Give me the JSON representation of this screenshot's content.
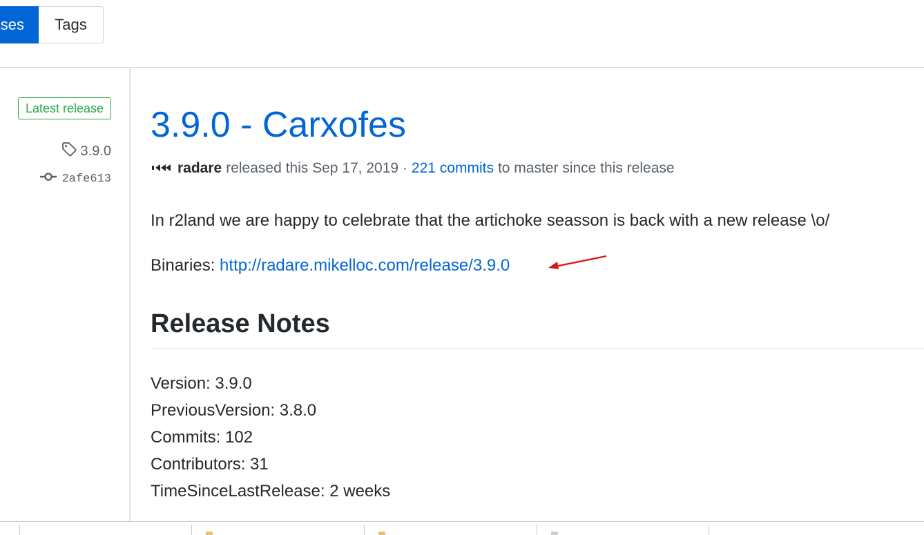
{
  "tabs": {
    "releases": "ses",
    "tags": "Tags"
  },
  "sidebar": {
    "badge": "Latest release",
    "tag": "3.9.0",
    "commit": "2afe613"
  },
  "release": {
    "title": "3.9.0 - Carxofes",
    "author": "radare",
    "released_text": "released this Sep 17, 2019 ·",
    "commits_link": "221 commits",
    "commits_suffix": "to master since this release",
    "intro": "In r2land we are happy to celebrate that the artichoke seasson is back with a new release \\o/",
    "binaries_label": "Binaries:",
    "binaries_link": "http://radare.mikelloc.com/release/3.9.0"
  },
  "notes": {
    "heading": "Release Notes",
    "lines": [
      "Version: 3.9.0",
      "PreviousVersion: 3.8.0",
      "Commits: 102",
      "Contributors: 31",
      "TimeSinceLastRelease: 2 weeks"
    ]
  },
  "colors": {
    "link": "#0366d6",
    "badge": "#28a745",
    "arrow": "#e0131a"
  }
}
